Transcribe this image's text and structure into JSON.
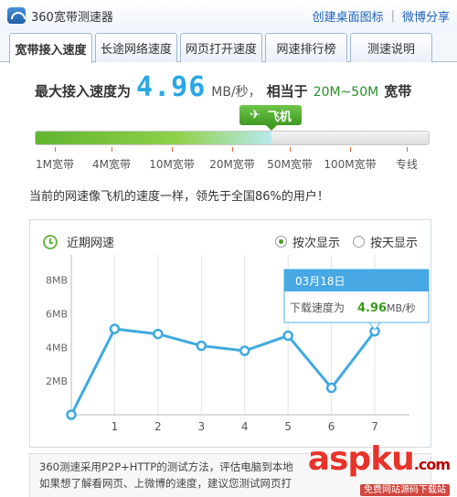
{
  "app": {
    "title": "360宽带测速器",
    "links": [
      "创建桌面图标",
      "微博分享"
    ]
  },
  "tabs": [
    {
      "label": "宽带接入速度",
      "active": true
    },
    {
      "label": "长途网络速度",
      "active": false
    },
    {
      "label": "网页打开速度",
      "active": false
    },
    {
      "label": "网速排行榜",
      "active": false
    },
    {
      "label": "测速说明",
      "active": false
    }
  ],
  "result": {
    "prefix": "最大接入速度为",
    "speed": "4.96",
    "unit": "MB/秒，",
    "equiv": "相当于",
    "range": "20M~50M",
    "suffix": "宽带"
  },
  "badge": {
    "icon": "airplane-icon",
    "label": "飞机"
  },
  "progress": {
    "fraction": 0.6
  },
  "bandwidth_ticks": [
    "1M宽带",
    "4M宽带",
    "10M宽带",
    "20M宽带",
    "50M宽带",
    "100M宽带",
    "专线"
  ],
  "compare_text": "当前的网速像飞机的速度一样，领先于全国86%的用户！",
  "chart_panel": {
    "title": "近期网速",
    "radio_options": [
      {
        "label": "按次显示",
        "checked": true
      },
      {
        "label": "按天显示",
        "checked": false
      }
    ]
  },
  "chart_data": {
    "type": "line",
    "x": [
      0,
      1,
      2,
      3,
      4,
      5,
      6,
      7
    ],
    "x_tick_labels": [
      "1",
      "2",
      "3",
      "4",
      "5",
      "6",
      "7"
    ],
    "y_tick_labels": [
      "2MB",
      "4MB",
      "6MB",
      "8MB"
    ],
    "values": [
      0,
      5.1,
      4.8,
      4.1,
      3.8,
      4.7,
      1.6,
      4.96
    ],
    "ylim": [
      0,
      9.5
    ],
    "xlim": [
      0,
      7.8
    ],
    "color": "#3fa9e0",
    "grid": "vertical",
    "tooltip": {
      "date": "03月18日",
      "label": "下载速度为",
      "value": "4.96",
      "unit": "MB/秒"
    }
  },
  "footer": {
    "line1": "360测速采用P2P+HTTP的测试方法，评估电脑到本地",
    "line2": "如果想了解看网页、上微博的速度，建议您测试网页打"
  },
  "watermark": {
    "logo": "aspku",
    "tld": ".com",
    "sub": "免费网站源码下载站"
  }
}
